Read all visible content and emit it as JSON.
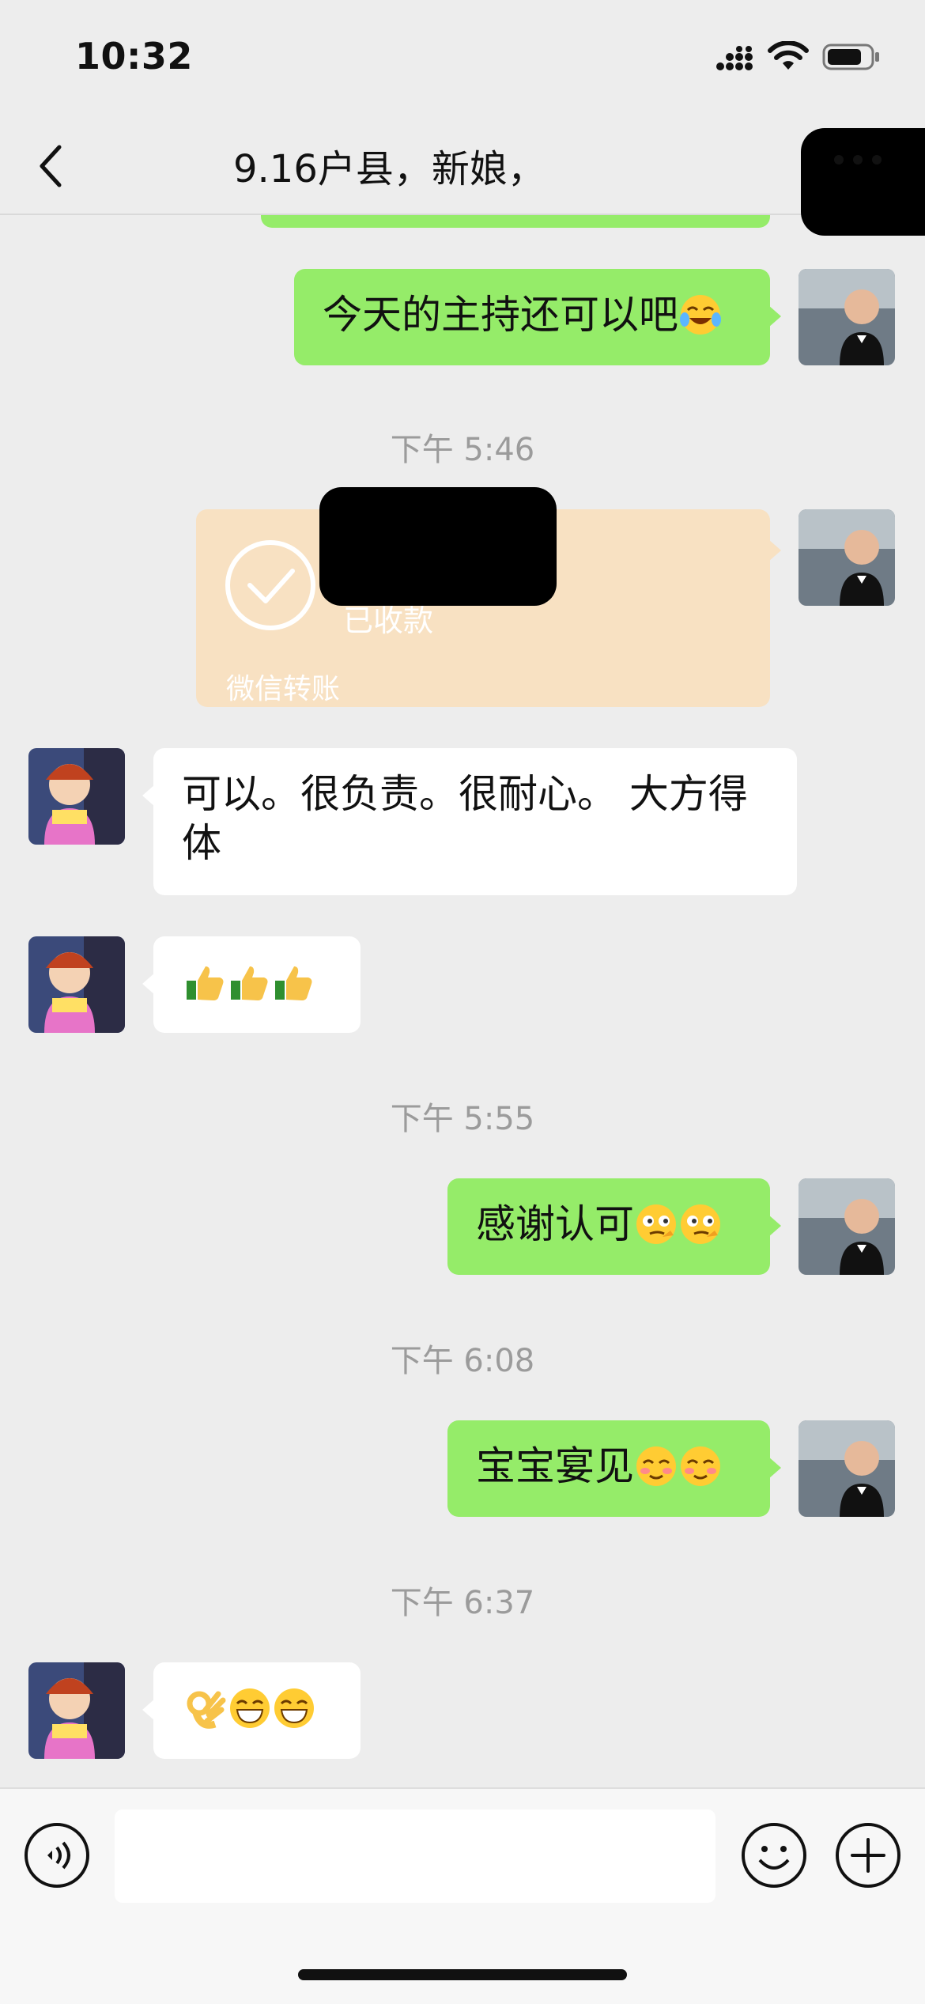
{
  "status_bar": {
    "time": "10:32"
  },
  "nav": {
    "title": "9.16户县，新娘，",
    "back_icon": "chevron-left-icon",
    "more_icon": "ellipsis-icon"
  },
  "messages": [
    {
      "side": "me",
      "text": "今天的主持还可以吧",
      "emoji": [
        "laugh-cry-emoji"
      ]
    },
    {
      "timestamp": "下午 5:46"
    },
    {
      "side": "me",
      "type": "transfer",
      "status": "已收款",
      "footer": "微信转账"
    },
    {
      "side": "other",
      "text": "可以。很负责。很耐心。 大方得\n体"
    },
    {
      "side": "other",
      "text": "",
      "emoji": [
        "thumbs-up-emoji",
        "thumbs-up-emoji",
        "thumbs-up-emoji"
      ]
    },
    {
      "timestamp": "下午 5:55"
    },
    {
      "side": "me",
      "text": "感谢认可",
      "emoji": [
        "smirk-emoji",
        "smirk-emoji"
      ]
    },
    {
      "timestamp": "下午 6:08"
    },
    {
      "side": "me",
      "text": "宝宝宴见",
      "emoji": [
        "blush-emoji",
        "blush-emoji"
      ]
    },
    {
      "timestamp": "下午 6:37"
    },
    {
      "side": "other",
      "text": "",
      "emoji": [
        "ok-hand-emoji",
        "grin-emoji",
        "grin-emoji"
      ]
    }
  ],
  "timestamps": [
    "下午 5:46",
    "下午 5:55",
    "下午 6:08",
    "下午 6:37"
  ],
  "transfer": {
    "status": "已收款",
    "footer": "微信转账"
  },
  "texts": {
    "m1": "今天的主持还可以吧",
    "m4": "可以。很负责。很耐心。 大方得\n体",
    "m6": "感谢认可",
    "m8": "宝宝宴见"
  },
  "input": {
    "value": "",
    "placeholder": ""
  },
  "colors": {
    "background": "#ededed",
    "bubble_me": "#95ec69",
    "bubble_other": "#ffffff",
    "transfer": "#f8e1c2",
    "timestamp": "#9b9b9b"
  }
}
